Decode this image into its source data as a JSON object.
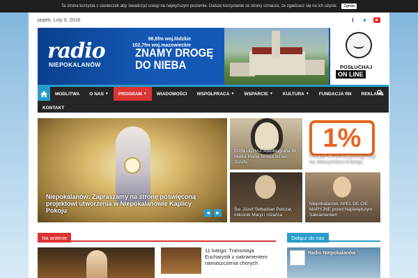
{
  "cookie": {
    "text": "Ta strona korzysta z ciasteczek aby świadczyć usługi na najwyższym poziomie. Dalsze korzystanie ze strony oznacza, że zgadzasz się na ich użycie.",
    "button": "Zgoda"
  },
  "topbar": {
    "date": "piątek, Luty 9, 2018"
  },
  "social": [
    "facebook-icon",
    "twitter-icon",
    "youtube-icon"
  ],
  "banner": {
    "logo_big": "radio",
    "logo_small": "NIEPOKALANÓW",
    "freq1": "98,6fm woj.łódzkie",
    "freq2": "102,7fm woj.mazowieckie",
    "slogan1": "ZNAMY DROGĘ",
    "slogan2": "DO NIEBA",
    "online1": "POSŁUCHAJ",
    "online2": "ON LINE"
  },
  "nav": {
    "items": [
      {
        "label": "MODLITWA",
        "caret": false
      },
      {
        "label": "O NAS",
        "caret": true
      },
      {
        "label": "PROGRAM",
        "caret": true,
        "active": true
      },
      {
        "label": "WIADOMOŚCI",
        "caret": false
      },
      {
        "label": "WSPÓŁPRACA",
        "caret": true
      },
      {
        "label": "WSPARCIE",
        "caret": true
      },
      {
        "label": "KULTURA",
        "caret": true
      },
      {
        "label": "FUNDACJA RN",
        "caret": false
      },
      {
        "label": "REKLAMA",
        "caret": false
      }
    ],
    "row2": "KONTAKT"
  },
  "slider": {
    "caption": "Niepokalanów: Zapraszamy na stronę poświęconą projektowi utworzenia w Niepokalanowie Kaplicy Pokoju"
  },
  "tiles": [
    {
      "caption": "POSŁUCHAJ: Autobiografia Bł. Matka Maria Teresa od św. Józefa"
    },
    {
      "caption": "Przekaż 1% na kontynuację misji św. Maksymiliana Kolbego",
      "big": "1%"
    },
    {
      "caption": "Św. Józef Sebastian Pelczar, miłośnik Maryi i różańca"
    },
    {
      "caption": "Niepokalanów: APEL DE CIE MARYJNE przed Najświętszym Sakramentem"
    }
  ],
  "sections": {
    "antenie": "Na antenie",
    "dolacz": "Dołącz do nas"
  },
  "news2": {
    "title": "11 lutego: Transmisja Eucharystii z sakramentem namaszczenia chorych"
  },
  "fb": {
    "name": "Radio Niepokalanów"
  }
}
